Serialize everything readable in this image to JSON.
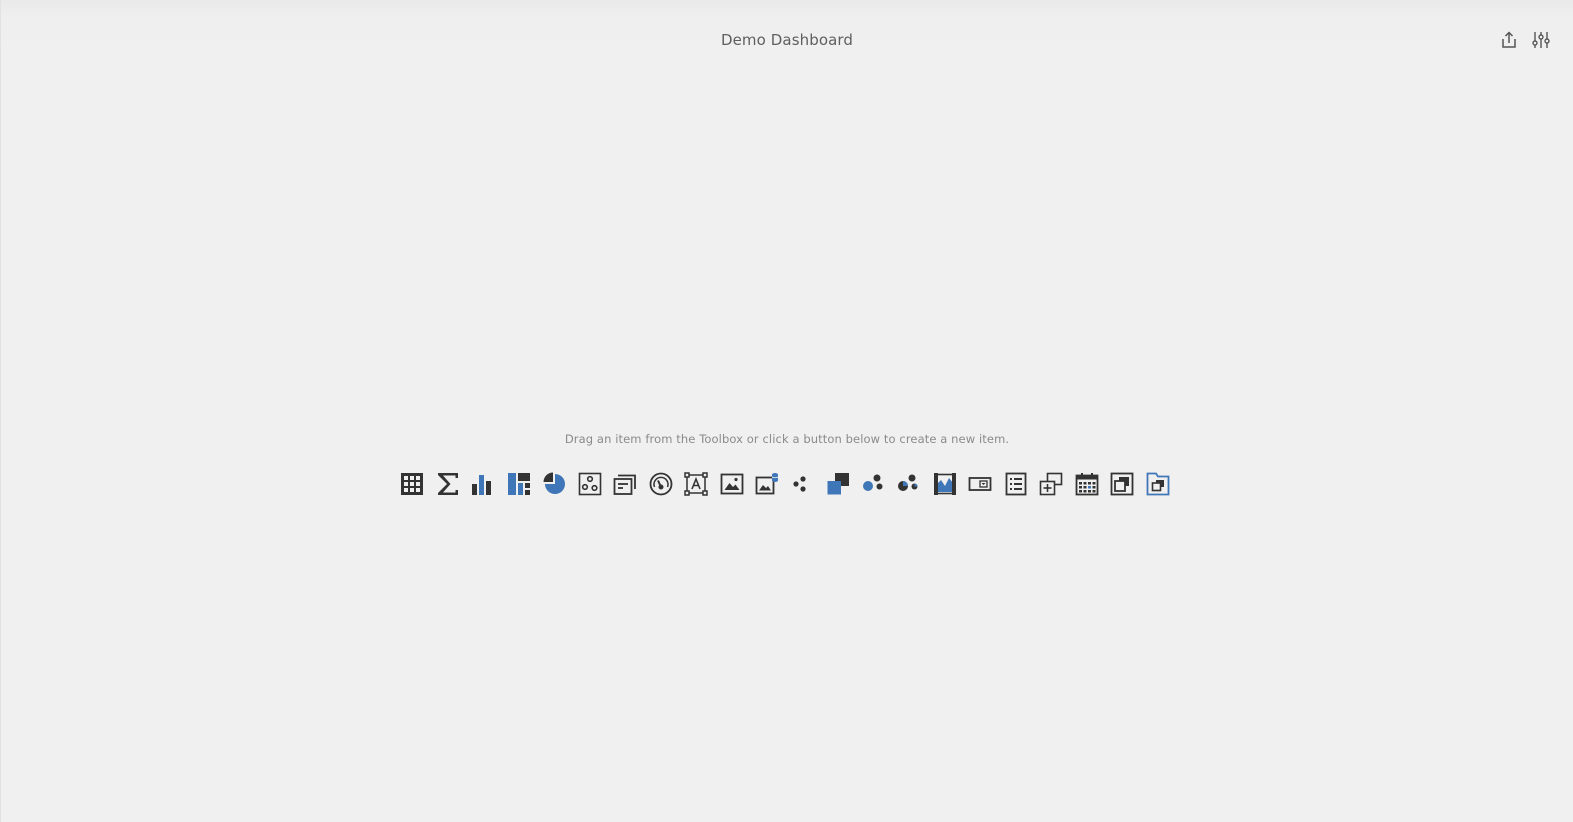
{
  "header": {
    "title": "Demo Dashboard",
    "actions": [
      {
        "name": "export-icon"
      },
      {
        "name": "parameters-icon"
      }
    ]
  },
  "empty_state": {
    "hint": "Drag an item from the Toolbox or click a button below to create a new item."
  },
  "toolbox": {
    "items": [
      {
        "name": "grid-icon"
      },
      {
        "name": "card-sum-icon"
      },
      {
        "name": "chart-icon"
      },
      {
        "name": "treemap-icon"
      },
      {
        "name": "pie-icon"
      },
      {
        "name": "scatter-chart-icon"
      },
      {
        "name": "cards-icon"
      },
      {
        "name": "gauge-icon"
      },
      {
        "name": "text-box-icon"
      },
      {
        "name": "image-icon"
      },
      {
        "name": "bound-image-icon"
      },
      {
        "name": "geo-point-map-icon"
      },
      {
        "name": "choropleth-map-icon"
      },
      {
        "name": "bubble-map-icon"
      },
      {
        "name": "pie-map-icon"
      },
      {
        "name": "range-filter-icon"
      },
      {
        "name": "combo-box-icon"
      },
      {
        "name": "list-box-icon"
      },
      {
        "name": "tree-view-icon"
      },
      {
        "name": "date-filter-icon"
      },
      {
        "name": "group-icon"
      },
      {
        "name": "tab-container-icon"
      }
    ]
  },
  "colors": {
    "background": "#f0f0f0",
    "icon_dark": "#333333",
    "icon_accent": "#3f76b8"
  }
}
